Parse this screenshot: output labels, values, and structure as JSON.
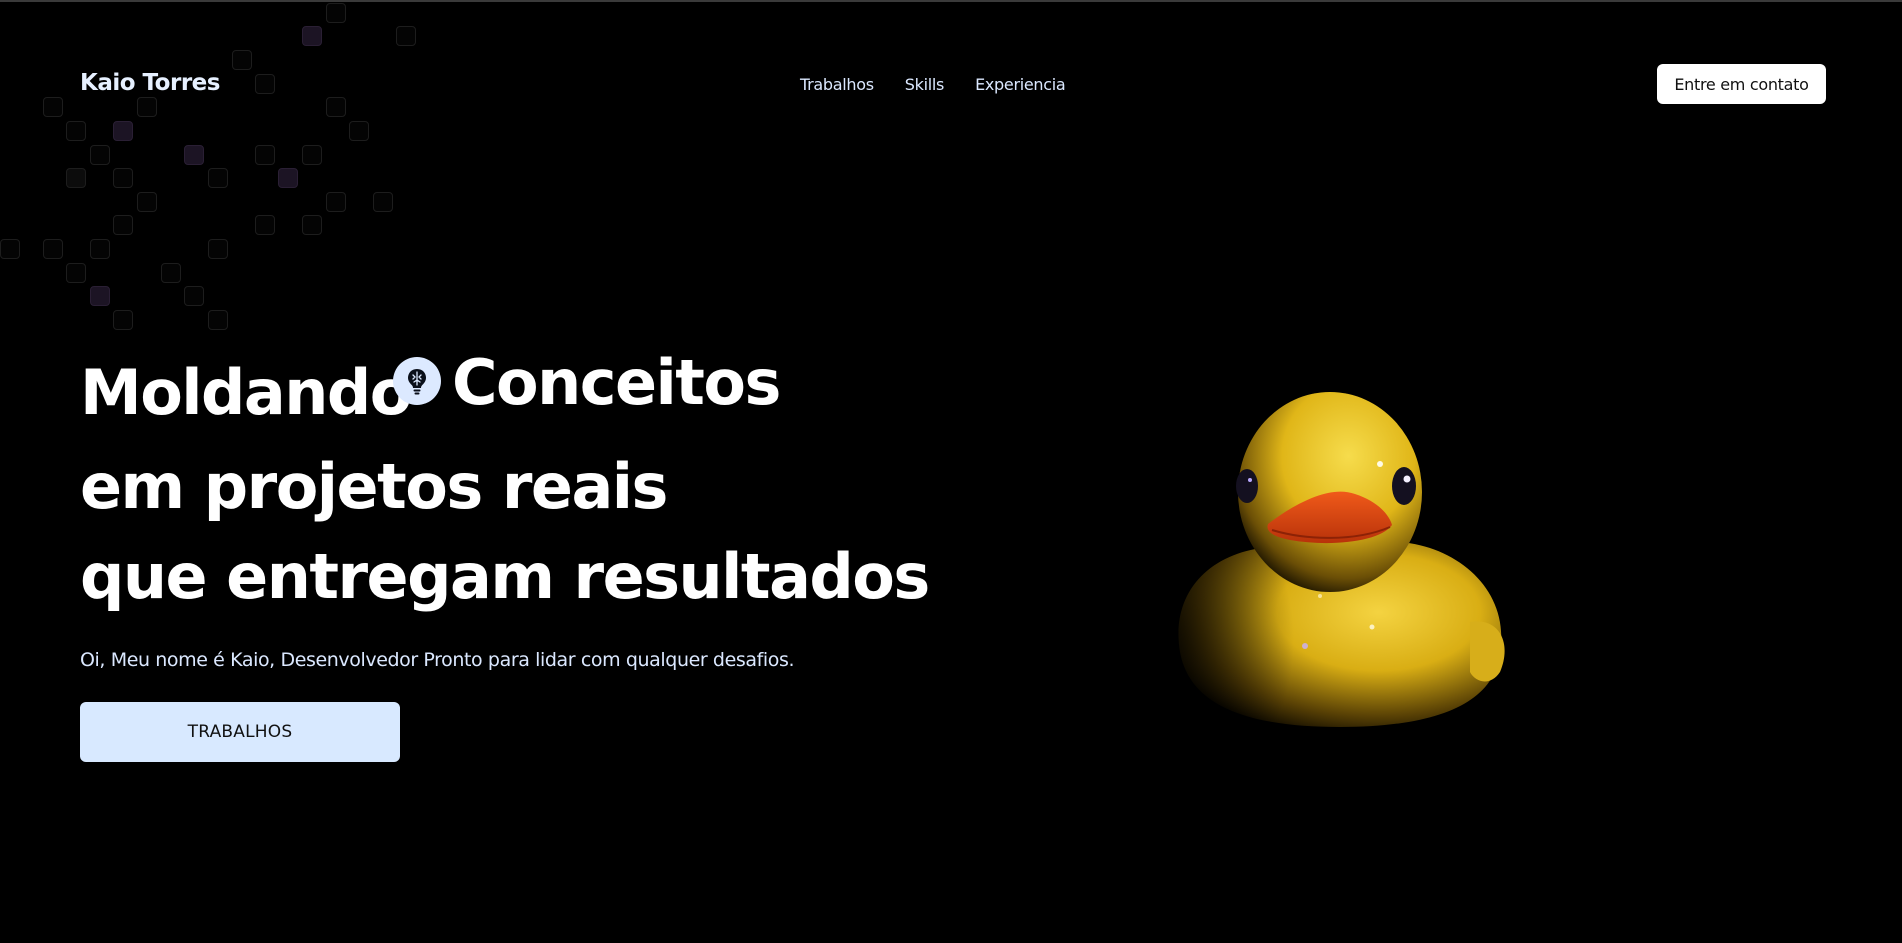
{
  "header": {
    "brand": "Kaio Torres",
    "nav": [
      "Trabalhos",
      "Skills",
      "Experiencia"
    ],
    "contact_label": "Entre em contato"
  },
  "hero": {
    "line1_a": "Moldando",
    "line1_b": "Conceitos",
    "line2": "em projetos reais",
    "line3": "que entregam resultados",
    "subtitle": "Oi, Meu nome é Kaio, Desenvolvedor Pronto para lidar com qualquer desafios.",
    "cta_label": "TRABALHOS"
  },
  "icons": {
    "badge": "lightbulb-icon",
    "illustration": "rubber-duck"
  },
  "colors": {
    "background": "#000000",
    "text": "#ffffff",
    "cta_bg": "#d8e9ff",
    "duck_yellow": "#f2c91e",
    "beak": "#e44c12"
  }
}
